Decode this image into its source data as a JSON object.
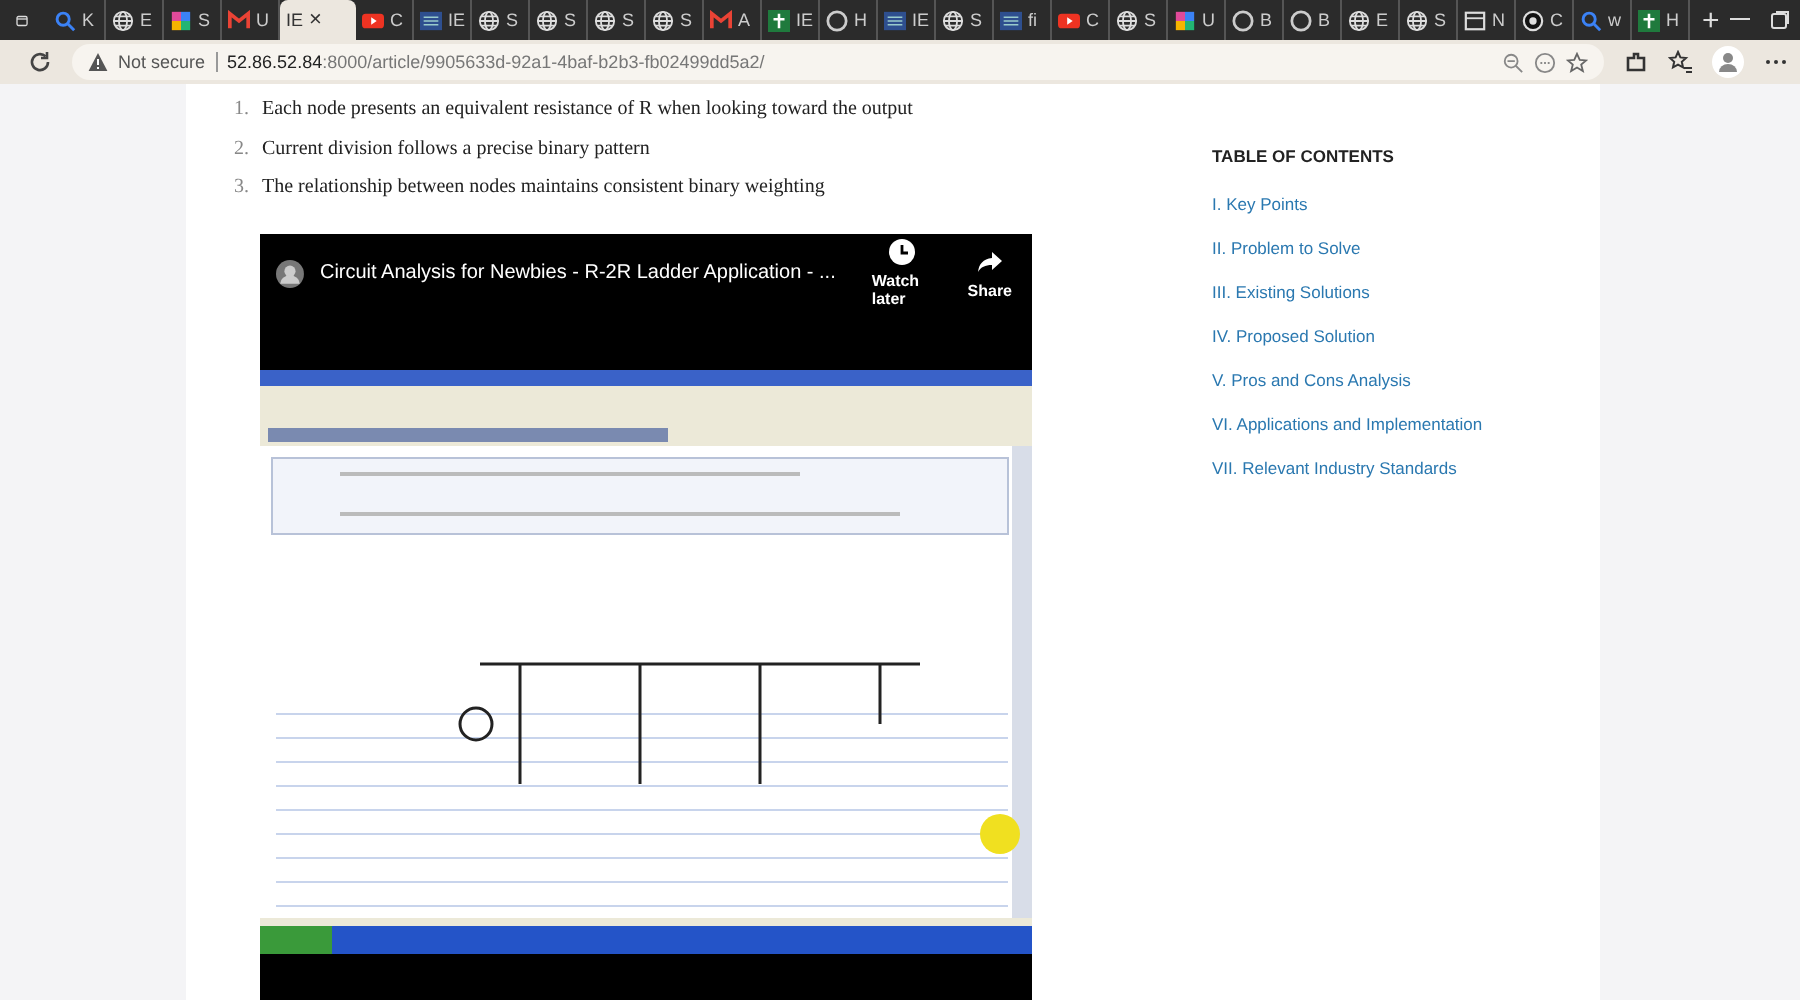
{
  "tabs": [
    {
      "kind": "search",
      "label": "K",
      "selected": false
    },
    {
      "kind": "globe",
      "label": "E",
      "selected": false
    },
    {
      "kind": "app",
      "label": "S",
      "selected": false
    },
    {
      "kind": "mail",
      "label": "U",
      "selected": false
    },
    {
      "kind": "plain",
      "label": "IE",
      "selected": true,
      "close": "×"
    },
    {
      "kind": "play",
      "label": "C",
      "selected": false
    },
    {
      "kind": "grid",
      "label": "IE",
      "selected": false
    },
    {
      "kind": "globe",
      "label": "S",
      "selected": false
    },
    {
      "kind": "globe",
      "label": "S",
      "selected": false
    },
    {
      "kind": "globe",
      "label": "S",
      "selected": false
    },
    {
      "kind": "globe",
      "label": "S",
      "selected": false
    },
    {
      "kind": "mail",
      "label": "A",
      "selected": false
    },
    {
      "kind": "cross",
      "label": "IE",
      "selected": false
    },
    {
      "kind": "dark",
      "label": "H",
      "selected": false
    },
    {
      "kind": "grid",
      "label": "IE",
      "selected": false
    },
    {
      "kind": "globe",
      "label": "S",
      "selected": false
    },
    {
      "kind": "grid",
      "label": "fi",
      "selected": false
    },
    {
      "kind": "play",
      "label": "C",
      "selected": false
    },
    {
      "kind": "globe",
      "label": "S",
      "selected": false
    },
    {
      "kind": "app",
      "label": "U",
      "selected": false
    },
    {
      "kind": "dark",
      "label": "B",
      "selected": false
    },
    {
      "kind": "dark",
      "label": "B",
      "selected": false
    },
    {
      "kind": "globe",
      "label": "E",
      "selected": false
    },
    {
      "kind": "globe",
      "label": "S",
      "selected": false
    },
    {
      "kind": "box",
      "label": "N",
      "selected": false
    },
    {
      "kind": "circle",
      "label": "C",
      "selected": false
    },
    {
      "kind": "search",
      "label": "w",
      "selected": false
    },
    {
      "kind": "cross",
      "label": "H",
      "selected": false
    }
  ],
  "new_tab": "+",
  "address_bar": {
    "security": "Not secure",
    "host": "52.86.52.84",
    "path": ":8000/article/9905633d-92a1-4baf-b2b3-fb02499dd5a2/"
  },
  "article": {
    "list": [
      {
        "number": "1.",
        "text": "Each node presents an equivalent resistance of R when looking toward the output"
      },
      {
        "number": "2.",
        "text": "Current division follows a precise binary pattern"
      },
      {
        "number": "3.",
        "text": "The relationship between nodes maintains consistent binary weighting"
      }
    ],
    "video": {
      "title": "Circuit Analysis for Newbies - R-2R Ladder Application - ...",
      "actions": [
        {
          "kind": "clock",
          "label": "Watch later"
        },
        {
          "kind": "share",
          "label": "Share"
        }
      ]
    }
  },
  "toc": {
    "title": "TABLE OF CONTENTS",
    "items": [
      "I. Key Points",
      "II. Problem to Solve",
      "III. Existing Solutions",
      "IV. Proposed Solution",
      "V. Pros and Cons Analysis",
      "VI. Applications and Implementation",
      "VII. Relevant Industry Standards"
    ]
  }
}
